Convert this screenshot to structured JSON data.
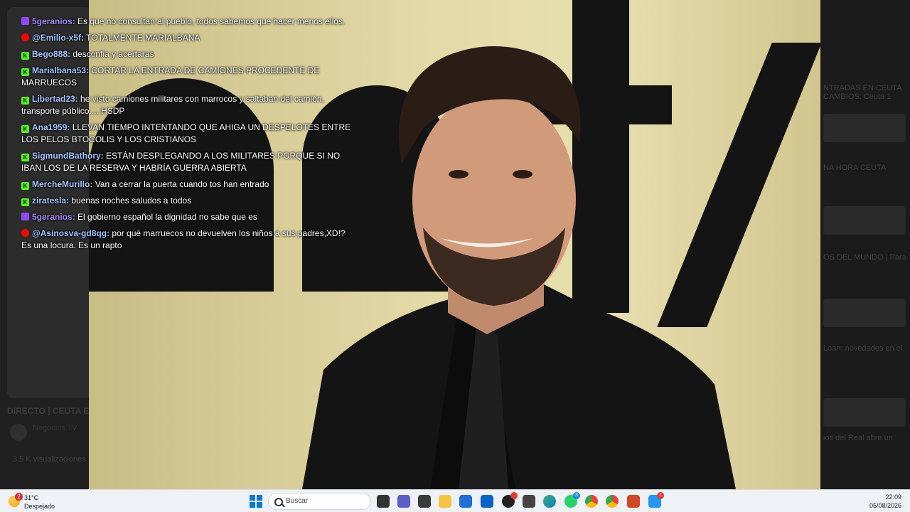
{
  "background_page": {
    "title": "DIRECTO | CEUTA E",
    "channel": "Negocios TV",
    "views": "3,5 K visualizaciones",
    "right_snippets": [
      "NTRADAS EN CEUTA",
      "CAMBIOS: Ceuta 1",
      "NA HORA CEUTA",
      "OS DEL MUNDO | Para",
      "Loan: novedades en el",
      "ios del Real abre un"
    ]
  },
  "chat": {
    "messages": [
      {
        "platform": "twitch",
        "user": "5geranios:",
        "text": "Es que no consultan al pueblo, todos sabemos que hacer menos ellos."
      },
      {
        "platform": "youtube",
        "user": "@Emilio-x5f:",
        "text": "TOTALMENTE MARIALBANA"
      },
      {
        "platform": "kick",
        "user": "Bego888:",
        "text": "desconfia y acertaras"
      },
      {
        "platform": "kick",
        "user": "Marialbana53:",
        "text": "CORTAR LA ENTRADA DE CAMIONES PROCEDENTE DE MARRUECOS"
      },
      {
        "platform": "kick",
        "user": "Libertad23:",
        "text": "he visto camiones militares con marrocos y saltaban del camión, transporte público.... HSDP"
      },
      {
        "platform": "kick",
        "user": "Ana1959:",
        "text": "LLEVAN TIEMPO INTENTANDO QUE AHIGA UN DESPELOTES ENTRE LOS PELOS BTOCOLIS Y LOS CRISTIANOS"
      },
      {
        "platform": "kick",
        "user": "SigmundBathory:",
        "text": "ESTÁN DESPLEGANDO A LOS MILITARES PORQUE SI NO IBAN LOS DE LA RESERVA Y HABRÍA GUERRA ABIERTA"
      },
      {
        "platform": "kick",
        "user": "MercheMurillo:",
        "text": "Van a cerrar la puerta cuando tos han entrado"
      },
      {
        "platform": "kick",
        "user": "ziratesla:",
        "text": "buenas noches saludos a todos"
      },
      {
        "platform": "twitch",
        "user": "5geranios:",
        "text": "El gobierno español la dignidad no sabe que es"
      },
      {
        "platform": "youtube",
        "user": "@Asinosva-gd8qg:",
        "text": "por qué marruecos no devuelven los niños a sus padres,XD!? Es una locura. Es un rapto"
      }
    ]
  },
  "taskbar": {
    "weather_temp": "31°C",
    "weather_desc": "Despejado",
    "weather_badge": "2",
    "search_placeholder": "Buscar",
    "time": "22:09",
    "date": "05/08/2026",
    "icons": [
      "start-icon",
      "search-icon",
      "widgets-icon",
      "teams-icon",
      "folder-icon",
      "store-icon",
      "outlook-icon",
      "obs-icon",
      "unity-icon",
      "edge-icon",
      "whatsapp-icon",
      "chrome-icon",
      "chrome-icon-2",
      "powerpoint-icon",
      "app-icon"
    ],
    "whatsapp_badge": "3",
    "app_badge": "1"
  }
}
